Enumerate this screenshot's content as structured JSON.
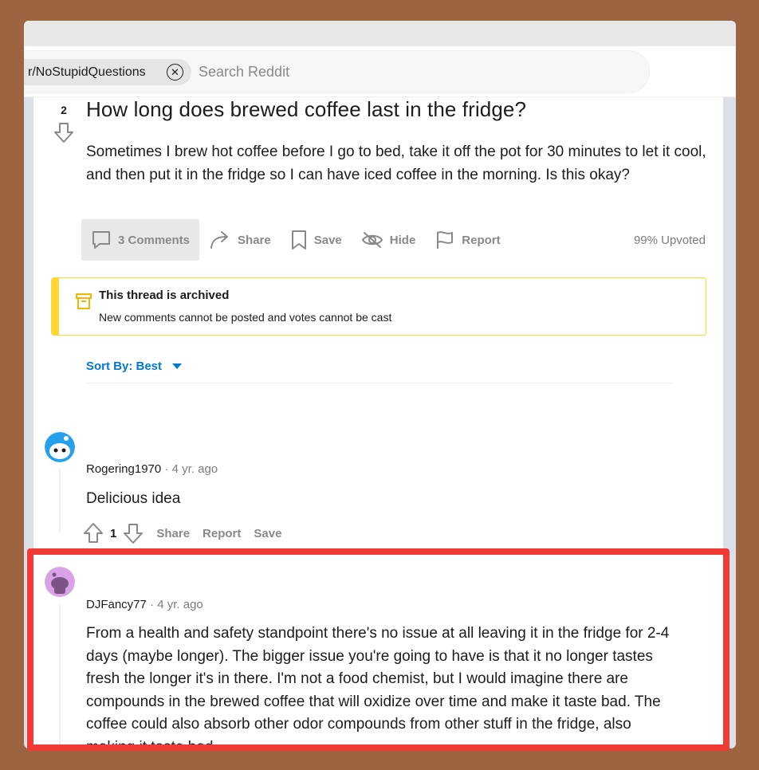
{
  "search": {
    "community": "r/NoStupidQuestions",
    "placeholder": "Search Reddit"
  },
  "post": {
    "votes": "2",
    "title": "How long does brewed coffee last in the fridge?",
    "body": "Sometimes I brew hot coffee before I go to bed, take it off the pot for 30 minutes to let it cool, and then put it in the fridge so I can have iced coffee in the morning. Is this okay?",
    "actions": {
      "comments": "3 Comments",
      "share": "Share",
      "save": "Save",
      "hide": "Hide",
      "report": "Report"
    },
    "upvoted": "99% Upvoted"
  },
  "archived": {
    "title": "This thread is archived",
    "subtitle": "New comments cannot be posted and votes cannot be cast"
  },
  "sort": {
    "label": "Sort By: Best"
  },
  "comments": [
    {
      "author": "Rogering1970",
      "time": "4 yr. ago",
      "body": "Delicious idea",
      "score": "1",
      "share": "Share",
      "report": "Report",
      "save": "Save"
    },
    {
      "author": "DJFancy77",
      "time": "4 yr. ago",
      "body": "From a health and safety standpoint there's no issue at all leaving it in the fridge for 2-4 days (maybe longer). The bigger issue you're going to have is that it no longer tastes fresh the longer it's in there. I'm not a food chemist, but I would imagine there are compounds in the brewed coffee that will oxidize over time and make it taste bad. The coffee could also absorb other odor compounds from other stuff in the fridge, also making it taste bad."
    }
  ],
  "colors": {
    "background": "#9c6440",
    "link_blue": "#0079d3",
    "archive_yellow": "#ffd635",
    "highlight_red": "#f03a36"
  }
}
